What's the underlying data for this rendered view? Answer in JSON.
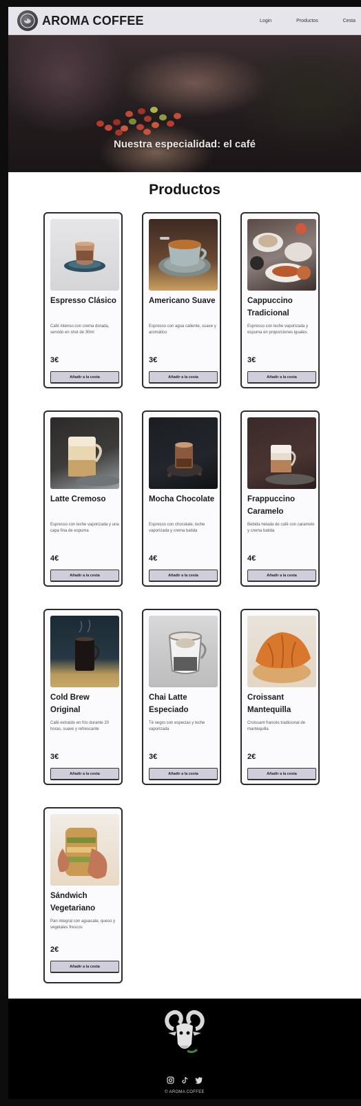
{
  "header": {
    "brand": "AROMA COFFEE",
    "nav": [
      "Login",
      "Productos",
      "Cesta"
    ]
  },
  "hero": {
    "title": "Nuestra especialidad: el café"
  },
  "products_section": {
    "title": "Productos",
    "button_label": "Añadir a la cesta",
    "items": [
      {
        "name": "Espresso Clásico",
        "desc": "Café intenso con crema dorada, servido en shot de 30ml",
        "price": "3€",
        "image": "espresso-cup-icon"
      },
      {
        "name": "Americano Suave",
        "desc": "Espresso con agua caliente, suave y aromático",
        "price": "3€",
        "image": "americano-cup-icon"
      },
      {
        "name": "Cappuccino Tradicional",
        "desc": "Espresso con leche vaporizada y espuma en proporciones iguales",
        "price": "3€",
        "image": "cappuccino-table-icon"
      },
      {
        "name": "Latte Cremoso",
        "desc": "Espresso con leche vaporizada y una capa fina de espuma",
        "price": "4€",
        "image": "latte-glass-icon"
      },
      {
        "name": "Mocha Chocolate",
        "desc": "Espresso con chocolate, leche vaporizada y crema batida",
        "price": "4€",
        "image": "mocha-cup-icon"
      },
      {
        "name": "Frappuccino Caramelo",
        "desc": "Bebida helada de café con caramelo y crema batida",
        "price": "4€",
        "image": "frappuccino-glass-icon"
      },
      {
        "name": "Cold Brew Original",
        "desc": "Café extraído en frío durante 20 horas, suave y refrescante",
        "price": "3€",
        "image": "cold-brew-glass-icon"
      },
      {
        "name": "Chai Latte Especiado",
        "desc": "Té negro con especias y leche vaporizada",
        "price": "3€",
        "image": "chai-latte-icon"
      },
      {
        "name": "Croissant Mantequilla",
        "desc": "Croissant francés tradicional de mantequilla",
        "price": "2€",
        "image": "croissant-icon"
      },
      {
        "name": "Sándwich Vegetariano",
        "desc": "Pan integral con aguacate, queso y vegetales frescos",
        "price": "2€",
        "image": "sandwich-icon"
      }
    ]
  },
  "footer": {
    "copyright": "© AROMA COFFEE",
    "social": [
      "instagram-icon",
      "tiktok-icon",
      "twitter-icon"
    ],
    "logo": "goat-logo-icon"
  },
  "colors": {
    "header_bg": "#e6e5ec",
    "button_bg": "#d0ceda",
    "footer_bg": "#000000",
    "card_border": "#2b2b2b"
  }
}
